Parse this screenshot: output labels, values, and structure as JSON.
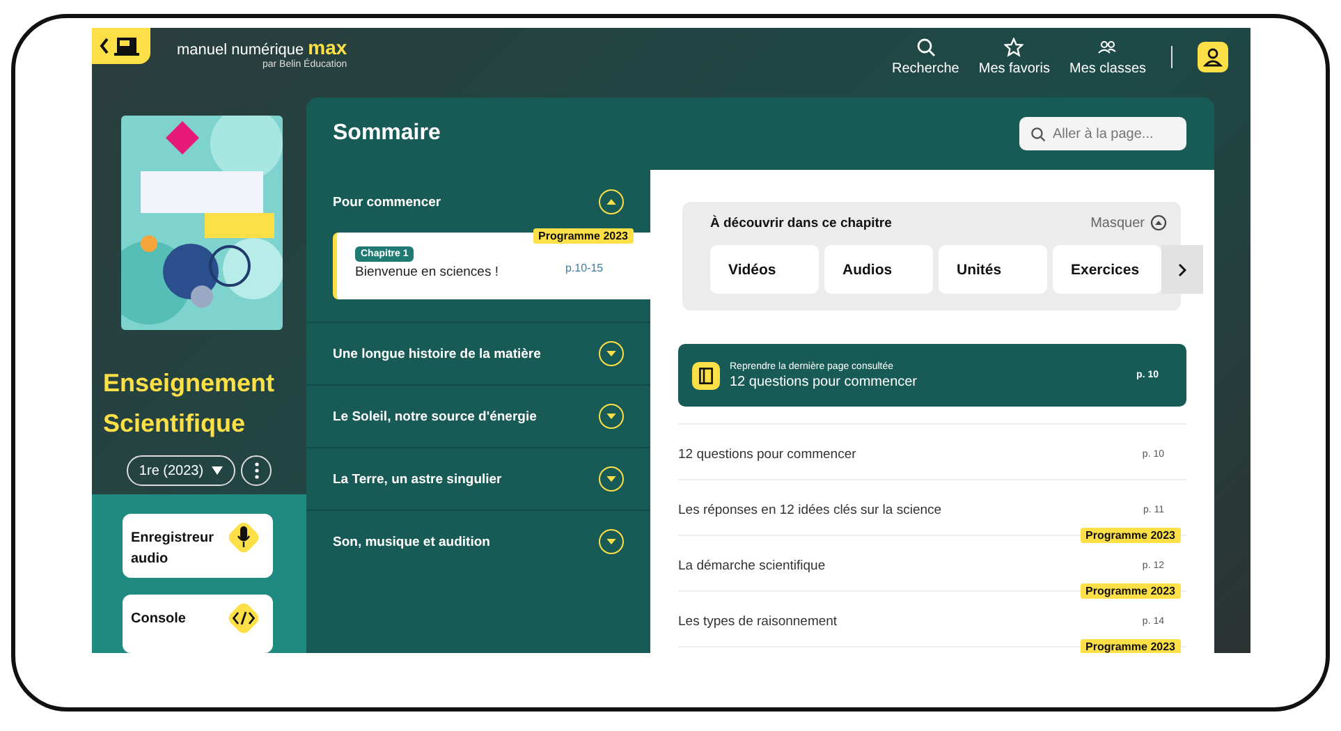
{
  "header": {
    "brand": "manuel numérique ",
    "brand_accent": "max",
    "publisher": "par Belin Éducation",
    "nav": [
      {
        "label": "Recherche"
      },
      {
        "label": "Mes favoris"
      },
      {
        "label": "Mes classes"
      }
    ]
  },
  "book": {
    "title": "Enseignement Scientifique",
    "level": "1re (2023)"
  },
  "tools": [
    {
      "label": "Enregistreur audio"
    },
    {
      "label": "Console"
    }
  ],
  "summary": {
    "title": "Sommaire",
    "search": {
      "placeholder": "Aller à la page..."
    },
    "sections": [
      {
        "title": "Pour commencer",
        "expanded": true,
        "chapters": [
          {
            "badge": "Programme 2023",
            "label": "Chapitre 1",
            "title": "Bienvenue en sciences !",
            "pages": "p.10-15"
          }
        ]
      },
      {
        "title": "Une longue histoire de la matière",
        "expanded": false
      },
      {
        "title": "Le Soleil, notre source d'énergie",
        "expanded": false
      },
      {
        "title": "La Terre, un astre singulier",
        "expanded": false
      },
      {
        "title": "Son, musique et audition",
        "expanded": false
      }
    ]
  },
  "discover": {
    "title": "À découvrir dans ce chapitre",
    "hide": "Masquer",
    "items": [
      "Vidéos",
      "Audios",
      "Unités",
      "Exercices"
    ]
  },
  "resume": {
    "label": "Reprendre la dernière page consultée",
    "title": "12 questions pour commencer",
    "page": "p. 10"
  },
  "pages": [
    {
      "title": "12 questions pour commencer",
      "page": "p. 10"
    },
    {
      "title": "Les réponses en 12 idées clés sur la science",
      "page": "p. 11"
    },
    {
      "badge": "Programme 2023",
      "title": "La démarche scientifique",
      "page": "p. 12"
    },
    {
      "badge": "Programme 2023",
      "title": "Les types de raisonnement",
      "page": "p. 14"
    },
    {
      "badge": "Programme 2023"
    }
  ]
}
